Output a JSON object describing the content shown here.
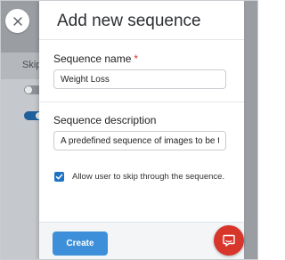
{
  "background": {
    "column_label": "Skip",
    "toggles": [
      {
        "state": "off"
      },
      {
        "state": "on"
      }
    ]
  },
  "drawer": {
    "title": "Add new sequence",
    "sequence_name": {
      "label": "Sequence name",
      "required_marker": "*",
      "value": "Weight Loss"
    },
    "sequence_description": {
      "label": "Sequence description",
      "value": "A predefined sequence of images to be t"
    },
    "skip_checkbox": {
      "checked": true,
      "label": "Allow user to skip through the sequence."
    },
    "create_label": "Create"
  },
  "icons": {
    "close": "close-icon",
    "checkbox_check": "checkmark-icon",
    "chat": "chat-icon"
  },
  "colors": {
    "accent": "#3d8fd9",
    "checkbox": "#1f73c4",
    "required": "#d33a2c",
    "chat_button": "#d8352b",
    "backdrop": "#9a9ea3"
  }
}
